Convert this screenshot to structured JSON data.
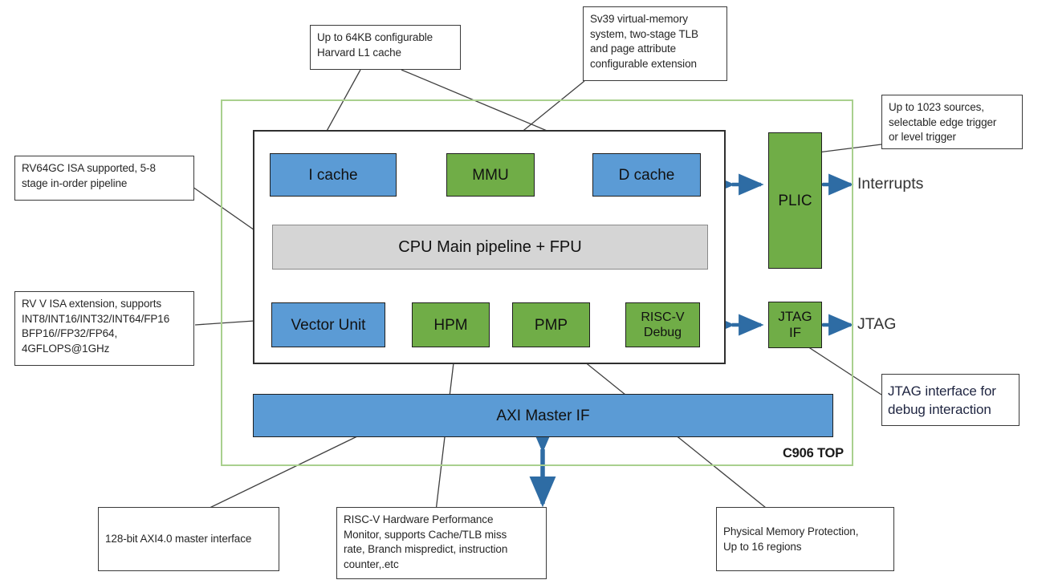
{
  "diagram": {
    "chip_label": "C906 TOP",
    "accent_blue": "#5B9BD5",
    "accent_green": "#70AD47",
    "accent_grey": "#D5D5D5",
    "boundary_green": "#A9D08E",
    "arrow_blue": "#2E6CA4"
  },
  "blocks": {
    "icache": "I cache",
    "mmu": "MMU",
    "dcache": "D cache",
    "pipeline": "CPU Main pipeline  + FPU",
    "vector": "Vector Unit",
    "hpm": "HPM",
    "pmp": "PMP",
    "debug_l1": "RISC-V",
    "debug_l2": "Debug",
    "plic": "PLIC",
    "jtagif_l1": "JTAG",
    "jtagif_l2": "IF",
    "axi": "AXI Master IF"
  },
  "ports": {
    "interrupts": "Interrupts",
    "jtag": "JTAG"
  },
  "callouts": {
    "l1_cache": {
      "lines": [
        "Up to 64KB configurable",
        "Harvard L1 cache"
      ]
    },
    "mmu": {
      "lines": [
        "Sv39 virtual-memory",
        "system, two-stage TLB",
        "and page attribute",
        "configurable extension"
      ]
    },
    "plic": {
      "lines": [
        "Up to 1023 sources,",
        "selectable edge trigger",
        "or level trigger"
      ]
    },
    "isa": {
      "lines": [
        "RV64GC ISA supported, 5-8",
        "stage in-order pipeline"
      ]
    },
    "vector": {
      "lines": [
        "RV V ISA extension, supports",
        "INT8/INT16/INT32/INT64/FP16",
        "BFP16//FP32/FP64,",
        "4GFLOPS@1GHz"
      ]
    },
    "jtag": {
      "lines": [
        "JTAG interface for",
        "debug interaction"
      ]
    },
    "axi": {
      "lines": [
        "128-bit AXI4.0 master interface"
      ]
    },
    "hpm": {
      "lines": [
        "RISC-V Hardware Performance",
        "Monitor, supports Cache/TLB miss",
        "rate, Branch mispredict, instruction",
        "counter,.etc"
      ]
    },
    "pmp": {
      "lines": [
        "Physical Memory Protection,",
        "Up to 16 regions"
      ]
    }
  }
}
